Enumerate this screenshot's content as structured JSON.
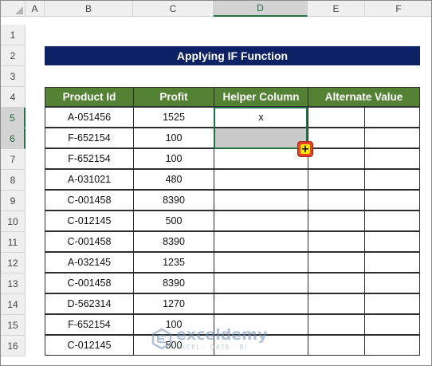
{
  "columns": [
    "A",
    "B",
    "C",
    "D",
    "E",
    "F"
  ],
  "rows": [
    "1",
    "2",
    "3",
    "4",
    "5",
    "6",
    "7",
    "8",
    "9",
    "10",
    "11",
    "12",
    "13",
    "14",
    "15",
    "16"
  ],
  "title": "Applying IF Function",
  "headers": {
    "product_id": "Product Id",
    "profit": "Profit",
    "helper": "Helper Column",
    "alternate": "Alternate Value"
  },
  "table": [
    {
      "id": "A-051456",
      "profit": "1525",
      "helper": "x"
    },
    {
      "id": "F-652154",
      "profit": "100",
      "helper": ""
    },
    {
      "id": "F-652154",
      "profit": "100",
      "helper": ""
    },
    {
      "id": "A-031021",
      "profit": "480",
      "helper": ""
    },
    {
      "id": "C-001458",
      "profit": "8390",
      "helper": ""
    },
    {
      "id": "C-012145",
      "profit": "500",
      "helper": ""
    },
    {
      "id": "C-001458",
      "profit": "8390",
      "helper": ""
    },
    {
      "id": "A-032145",
      "profit": "1235",
      "helper": ""
    },
    {
      "id": "C-001458",
      "profit": "8390",
      "helper": ""
    },
    {
      "id": "D-562314",
      "profit": "1270",
      "helper": ""
    },
    {
      "id": "F-652154",
      "profit": "100",
      "helper": ""
    },
    {
      "id": "C-012145",
      "profit": "500",
      "helper": ""
    }
  ],
  "fill_handle_glyph": "+",
  "watermark": {
    "name": "exceldemy",
    "tagline": "EXCEL · DATA · BI"
  },
  "colors": {
    "title_bg": "#0d2265",
    "header_bg": "#548235",
    "selection": "#217346",
    "selected_fill": "#c9c9c9"
  }
}
